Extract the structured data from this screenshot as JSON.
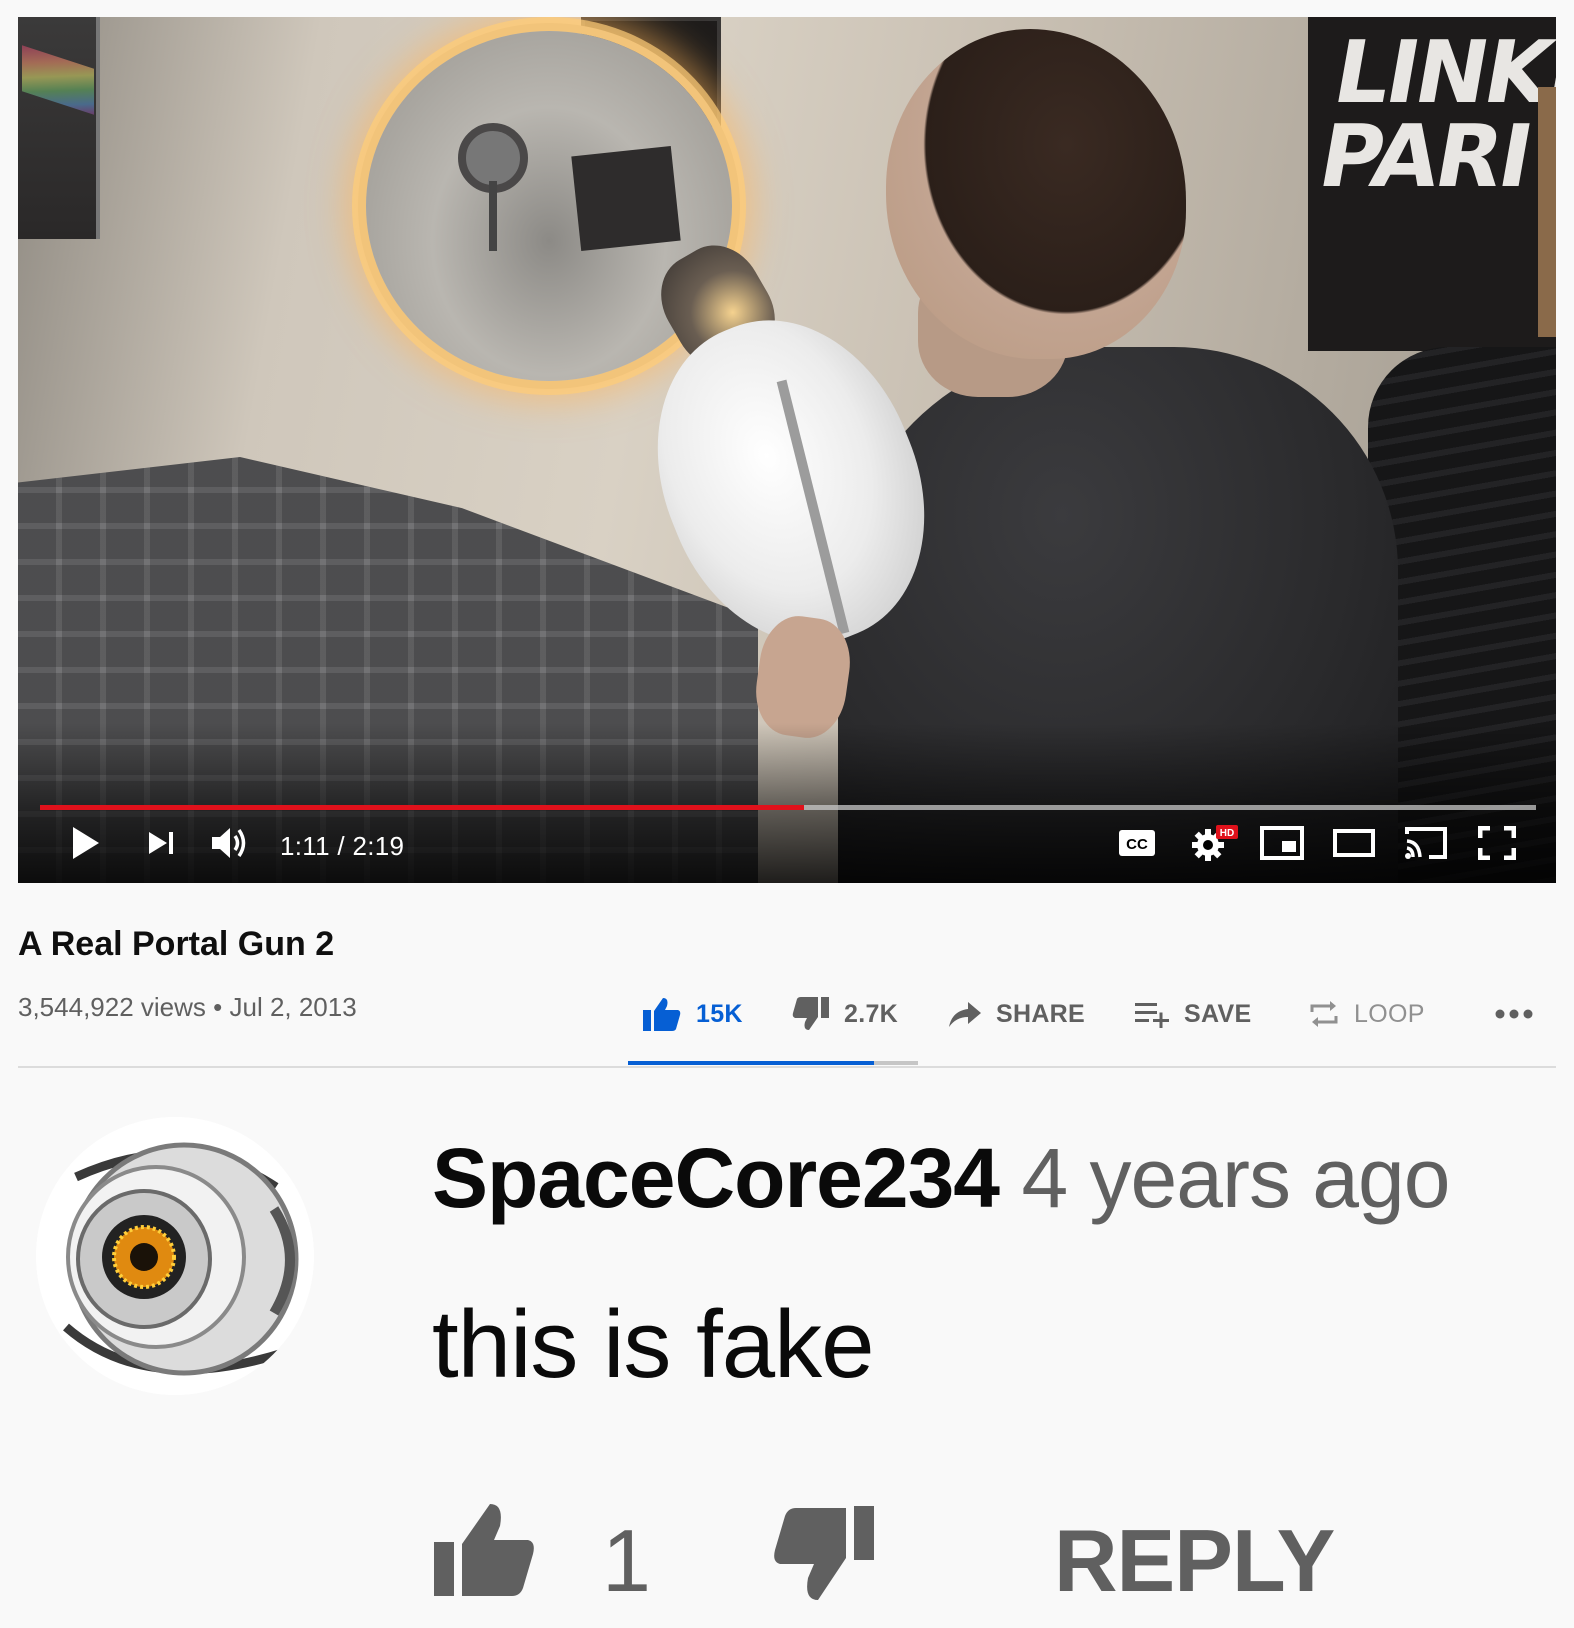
{
  "player": {
    "poster_text": "LINKI\nPARI",
    "time_current": "1:11",
    "time_total": "2:19",
    "time_display": "1:11 / 2:19",
    "progress_fraction": 0.511,
    "hd_badge": "HD",
    "cc_label": "CC",
    "accent_color": "#e0111b",
    "icons": [
      "play-icon",
      "next-icon",
      "volume-icon",
      "captions-icon",
      "settings-icon",
      "miniplayer-icon",
      "theater-icon",
      "cast-icon",
      "fullscreen-icon"
    ]
  },
  "video": {
    "title": "A Real Portal Gun 2",
    "views": "3,544,922 views",
    "separator": "•",
    "date": "Jul 2, 2013"
  },
  "actions": {
    "like_count": "15K",
    "dislike_count": "2.7K",
    "share_label": "SHARE",
    "save_label": "SAVE",
    "loop_label": "LOOP",
    "like_ratio": 0.847,
    "like_color": "#065fd4"
  },
  "comment": {
    "author": "SpaceCore234",
    "time_ago": "4 years ago",
    "text": "this is fake",
    "like_count": "1",
    "reply_label": "REPLY"
  }
}
